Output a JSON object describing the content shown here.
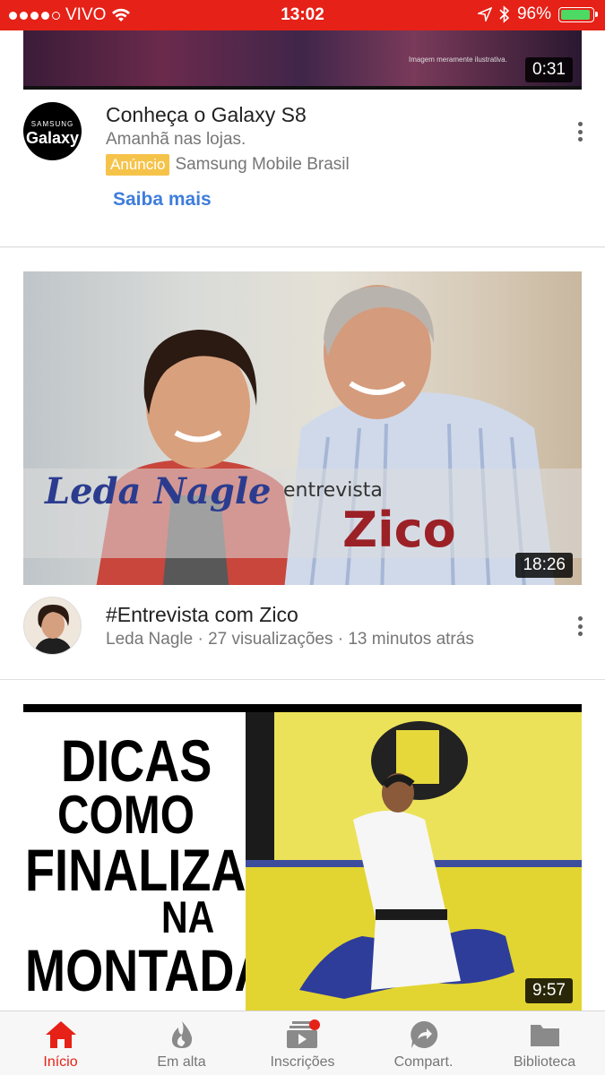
{
  "status_bar": {
    "carrier": "VIVO",
    "time": "13:02",
    "battery": "96%",
    "battery_level": 0.96
  },
  "feed": [
    {
      "type": "ad",
      "duration": "0:31",
      "disclaimer": "Imagem meramente ilustrativa.",
      "channel_logo_lines": [
        "SAMSUNG",
        "Galaxy"
      ],
      "title": "Conheça o Galaxy S8",
      "subtitle": "Amanhã nas lojas.",
      "badge": "Anúncio",
      "advertiser": "Samsung Mobile Brasil",
      "cta": "Saiba mais"
    },
    {
      "type": "video",
      "duration": "18:26",
      "thumb_text": [
        "Leda Nagle",
        "entrevista",
        "Zico"
      ],
      "title": "#Entrevista com Zico",
      "meta": "Leda Nagle · 27 visualizações · 13 minutos atrás"
    },
    {
      "type": "video",
      "duration": "9:57",
      "thumb_text": [
        "DICAS",
        "COMO",
        "FINALIZAR",
        "NA",
        "MONTADA"
      ]
    }
  ],
  "bottom_nav": [
    {
      "label": "Início",
      "icon": "home-icon",
      "active": true
    },
    {
      "label": "Em alta",
      "icon": "flame-icon",
      "active": false
    },
    {
      "label": "Inscrições",
      "icon": "subscriptions-icon",
      "active": false
    },
    {
      "label": "Compart.",
      "icon": "share-icon",
      "active": false
    },
    {
      "label": "Biblioteca",
      "icon": "folder-icon",
      "active": false
    }
  ],
  "colors": {
    "brand": "#e62117",
    "link": "#3e7ddb",
    "badge": "#f6c34a",
    "battery": "#4cd964"
  }
}
